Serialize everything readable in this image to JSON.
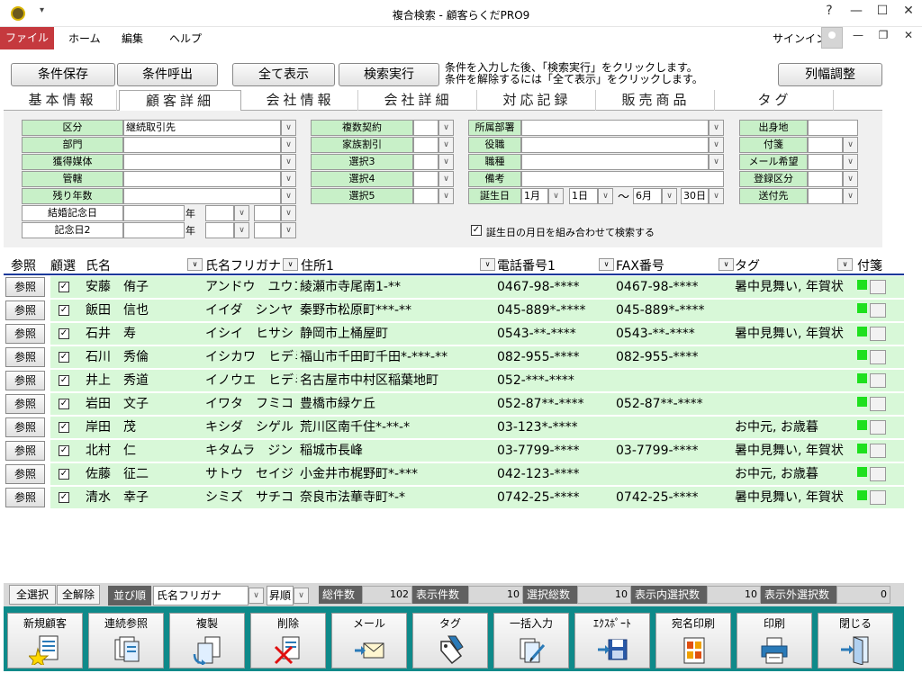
{
  "window": {
    "title": "複合検索 - 顧客らくだPRO9",
    "help": "?",
    "minimize": "—",
    "maximize": "☐",
    "close": "✕"
  },
  "ribbon": {
    "file": "ファイル",
    "tabs": [
      "ホーム",
      "編集",
      "ヘルプ"
    ],
    "signin": "サインイン",
    "rmin": "—",
    "rrestore": "❐",
    "rclose": "✕"
  },
  "top_buttons": {
    "save": "条件保存",
    "load": "条件呼出",
    "showall": "全て表示",
    "search": "検索実行",
    "colwidth": "列幅調整"
  },
  "notes": [
    "条件を入力した後、「検索実行」をクリックします。",
    "条件を解除するには「全て表示」をクリックします。"
  ],
  "tabs": [
    "基本情報",
    "顧客詳細",
    "会社情報",
    "会社詳細",
    "対応記録",
    "販売商品",
    "タグ"
  ],
  "form": {
    "col1": [
      "区分",
      "部門",
      "獲得媒体",
      "管轄",
      "残り年数"
    ],
    "col1_value": "継続取引先",
    "anniv": [
      "結婚記念日",
      "記念日2"
    ],
    "year": "年",
    "col2": [
      "複数契約",
      "家族割引",
      "選択3",
      "選択4",
      "選択5"
    ],
    "col3": [
      "所属部署",
      "役職",
      "職種",
      "備考"
    ],
    "birth_label": "誕生日",
    "birth": {
      "m1": "1月",
      "d1": "1日",
      "tilde": "〜",
      "m2": "6月",
      "d2": "30日"
    },
    "birth_check": "誕生日の月日を組み合わせて検索する",
    "col4": [
      "出身地",
      "付箋",
      "メール希望",
      "登録区分",
      "送付先"
    ]
  },
  "columns": {
    "ref": "参照",
    "sel": "顧選",
    "name": "氏名",
    "kana": "氏名フリガナ",
    "addr": "住所1",
    "tel": "電話番号1",
    "fax": "FAX番号",
    "tag": "タグ",
    "fusen": "付箋"
  },
  "ref_label": "参照",
  "rows": [
    {
      "name": "安藤　侑子",
      "kana": "アンドウ　ユウコ",
      "addr": "綾瀬市寺尾南1-**",
      "tel": "0467-98-****",
      "fax": "0467-98-****",
      "tag": "暑中見舞い, 年賀状"
    },
    {
      "name": "飯田　信也",
      "kana": "イイダ　シンヤ",
      "addr": "秦野市松原町***-**",
      "tel": "045-889*-****",
      "fax": "045-889*-****",
      "tag": ""
    },
    {
      "name": "石井　寿",
      "kana": "イシイ　ヒサシ",
      "addr": "静岡市上桶屋町",
      "tel": "0543-**-****",
      "fax": "0543-**-****",
      "tag": "暑中見舞い, 年賀状"
    },
    {
      "name": "石川　秀倫",
      "kana": "イシカワ　ヒデミチ",
      "addr": "福山市千田町千田*-***-**",
      "tel": "082-955-****",
      "fax": "082-955-****",
      "tag": ""
    },
    {
      "name": "井上　秀道",
      "kana": "イノウエ　ヒデミチ",
      "addr": "名古屋市中村区稲葉地町",
      "tel": "052-***-****",
      "fax": "",
      "tag": ""
    },
    {
      "name": "岩田　文子",
      "kana": "イワタ　フミコ",
      "addr": "豊橋市緑ケ丘",
      "tel": "052-87**-****",
      "fax": "052-87**-****",
      "tag": ""
    },
    {
      "name": "岸田　茂",
      "kana": "キシダ　シゲル",
      "addr": "荒川区南千住*-**-*",
      "tel": "03-123*-****",
      "fax": "",
      "tag": "お中元, お歳暮"
    },
    {
      "name": "北村　仁",
      "kana": "キタムラ　ジン",
      "addr": "稲城市長峰",
      "tel": "03-7799-****",
      "fax": "03-7799-****",
      "tag": "暑中見舞い, 年賀状"
    },
    {
      "name": "佐藤　征二",
      "kana": "サトウ　セイジ",
      "addr": "小金井市梶野町*-***",
      "tel": "042-123-****",
      "fax": "",
      "tag": "お中元, お歳暮"
    },
    {
      "name": "清水　幸子",
      "kana": "シミズ　サチコ",
      "addr": "奈良市法華寺町*-*",
      "tel": "0742-25-****",
      "fax": "0742-25-****",
      "tag": "暑中見舞い, 年賀状"
    }
  ],
  "bottom": {
    "selall": "全選択",
    "deselall": "全解除",
    "sort_label": "並び順",
    "sort_value": "氏名フリガナ",
    "order": "昇順",
    "stats": [
      {
        "label": "総件数",
        "value": "102"
      },
      {
        "label": "表示件数",
        "value": "10"
      },
      {
        "label": "選択総数",
        "value": "10"
      },
      {
        "label": "表示内選択数",
        "value": "10"
      },
      {
        "label": "表示外選択数",
        "value": "0"
      }
    ]
  },
  "toolbar": [
    "新規顧客",
    "連続参照",
    "複製",
    "削除",
    "メール",
    "タグ",
    "一括入力",
    "ｴｸｽﾎﾟｰﾄ",
    "宛名印刷",
    "印刷",
    "閉じる"
  ],
  "colors": {
    "file_tab": "#c5393e",
    "row_bg": "#d8f8d8",
    "label_bg": "#c8f0c8",
    "toolbar_bg": "#0e8a8a",
    "fusen": "#1ee01e"
  }
}
